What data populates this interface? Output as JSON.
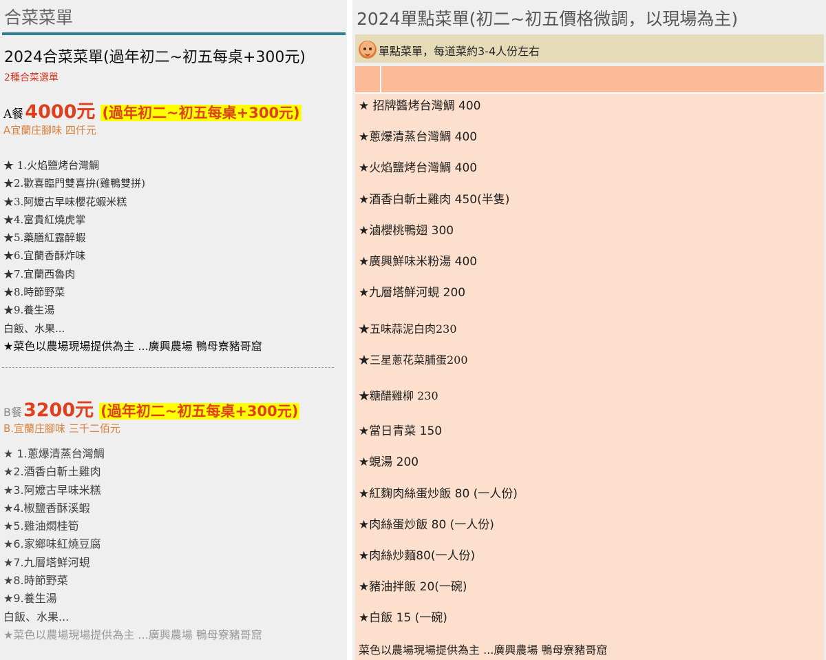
{
  "left": {
    "title": "合菜菜單",
    "heading": "2024合菜菜單(過年初二~初五每桌+300元)",
    "subheading": "2種合菜選單",
    "set_a": {
      "letter": "A餐",
      "price": "4000元",
      "note": "(過年初二~初五每桌+300元)",
      "subtitle": "A宜蘭庄腳味  四仟元",
      "dishes": [
        "★ 1.火焰鹽烤台灣鯛",
        "★2.歡喜臨門雙喜拚(雞鴨雙拼)",
        "★3.阿嬤古早味櫻花蝦米糕",
        "★4.富貴紅燒虎掌",
        "★5.藥膳紅露醉蝦",
        "★6.宜蘭香酥炸味",
        "★7.宜蘭西魯肉",
        "★8.時節野菜",
        "★9.養生湯",
        "白飯、水果..."
      ],
      "footer": "★菜色以農場現場提供為主 ...廣興農場 鴨母寮豬哥窟"
    },
    "set_b": {
      "letter": "B餐",
      "price": "3200元",
      "note": "(過年初二~初五每桌+300元)",
      "subtitle": "B.宜蘭庄腳味  三千二佰元",
      "dishes": [
        "★ 1.蔥爆清蒸台灣鯛",
        "★2.酒香白斬土雞肉",
        "★3.阿嬤古早味米糕",
        "★4.椒鹽香酥溪蝦",
        "★5.雞油燜桂筍",
        "★6.家鄉味紅燒豆腐",
        "★7.九層塔鮮河蜆",
        "★8.時節野菜",
        "★9.養生湯",
        "白飯、水果..."
      ],
      "footer": "★菜色以農場現場提供為主 ...廣興農場 鴨母寮豬哥窟"
    }
  },
  "right": {
    "title": "2024單點菜單(初二~初五價格微調，以現場為主)",
    "band_icon": "pig-face-icon",
    "band_text": "單點菜單，每道菜約3-4人份左右",
    "dishes": [
      {
        "text": "★ 招牌醬烤台灣鯛 400",
        "serif": false
      },
      {
        "text": "★蔥爆清蒸台灣鯛 400",
        "serif": false
      },
      {
        "text": "★火焰鹽烤台灣鯛 400",
        "serif": false
      },
      {
        "text": "★酒香白斬土雞肉 450(半隻)",
        "serif": false
      },
      {
        "text": "★滷櫻桃鴨翅 300",
        "serif": false
      },
      {
        "text": "★廣興鮮味米粉湯 400",
        "serif": false
      },
      {
        "text": "★九層塔鮮河蜆 200",
        "serif": false
      },
      {
        "text": "★五味蒜泥白肉230",
        "serif": true
      },
      {
        "text": "★三星蔥花菜脯蛋200",
        "serif": true
      },
      {
        "text": "★糖醋雞柳 230",
        "serif": true
      },
      {
        "text": "★當日青菜 150",
        "serif": false
      },
      {
        "text": "★蜆湯 200",
        "serif": false
      },
      {
        "text": "★紅麴肉絲蛋炒飯 80 (一人份)",
        "serif": false
      },
      {
        "text": "★肉絲蛋炒飯 80 (一人份)",
        "serif": false
      },
      {
        "text": "★肉絲炒麵80(一人份)",
        "serif": false
      },
      {
        "text": "★豬油拌飯 20(一碗)",
        "serif": false
      },
      {
        "text": "★白飯 15 (一碗)",
        "serif": false
      }
    ],
    "footer": "菜色以農場現場提供為主 ...廣興農場 鴨母寮豬哥窟"
  }
}
